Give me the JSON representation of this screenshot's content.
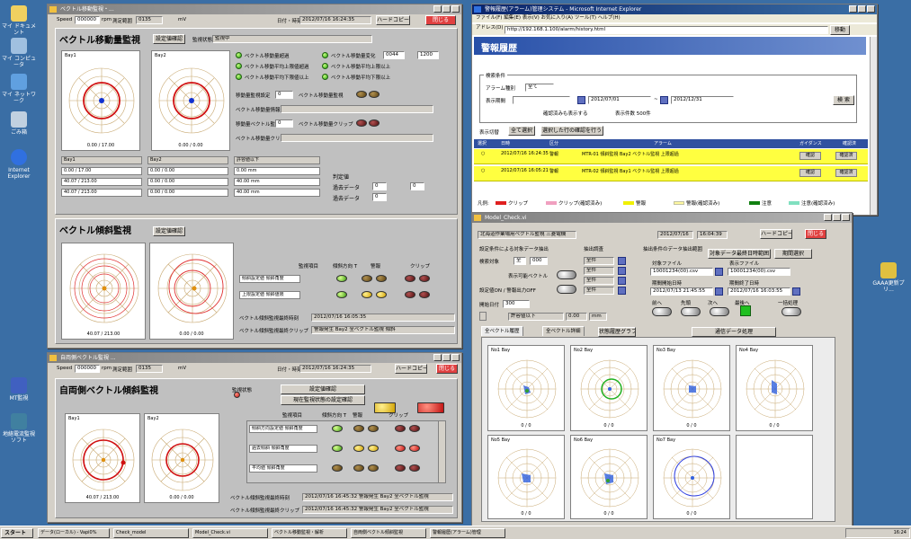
{
  "desktop_icons": [
    {
      "label": "マイ ドキュメント",
      "color": "#f0d060"
    },
    {
      "label": "マイ コンピュータ",
      "color": "#a0c0e0"
    },
    {
      "label": "マイ ネットワーク",
      "color": "#60a0e0"
    },
    {
      "label": "ごみ箱",
      "color": "#c0d0e0"
    },
    {
      "label": "Internet Explorer",
      "color": "#3070e0"
    },
    {
      "label": "MT監視",
      "color": "#4060c0"
    },
    {
      "label": "地絡電流監視ソフト",
      "color": "#4080a0"
    }
  ],
  "desktop_right_icon": {
    "label": "GAAA更新プリ..."
  },
  "win1": {
    "title": "ベクトル移動監視・...",
    "speed_label": "Speed",
    "speed_value": "000000",
    "speed_unit": "rpm",
    "range_label": "測定範囲",
    "range_value": "0135",
    "range_unit": "mV",
    "datetime_label": "日付・時刻",
    "datetime_value": "2012/07/16 16:24:35",
    "hardcopy_button": "ハードコピー",
    "close_button": "閉じる",
    "panel1": {
      "title": "ベクトル移動量監視",
      "settings_button": "設定値確認",
      "status_label": "監視状態",
      "status_value": "監視中",
      "polar1_label": "Bay1",
      "polar2_label": "Bay2",
      "polar1_value": "0.00 / 17.00",
      "polar2_value": "0.00 / 0.00",
      "checks": [
        "ベクトル移動量超過",
        "ベクトル移動平均上限値超過",
        "ベクトル移動平均下限値以上"
      ],
      "checks_right": [
        "ベクトル移動量変化",
        "ベクトル移動平均上限以上",
        "ベクトル移動平均下限以上"
      ],
      "threshold_value": "0044",
      "threshold_value2": "1200",
      "alarm_label": "移動量監視設定",
      "alarm_value": "0",
      "alarm_label2": "ベクトル移動量監視",
      "info_label": "ベクトル移動量情報",
      "count_label": "移動量ベクトル監視",
      "count_value": "0",
      "count_label2": "ベクトル移動量クリップ",
      "clip_label": "ベクトル移動量クリップ",
      "table_headers": [
        "Bay1",
        "Bay2",
        "許容値以下"
      ],
      "table_rows": [
        [
          "0.00 /  17.00",
          "0.00 / 0.00",
          "0.00  mm"
        ],
        [
          "40.07 /  213.00",
          "0.00 / 0.00",
          "40.00  mm"
        ],
        [
          "40.07 /  213.00",
          "0.00 / 0.00",
          "40.00  mm"
        ]
      ],
      "side_labels": [
        "判定値",
        "過去データ",
        "過去データ"
      ],
      "side_values": [
        "0",
        "0",
        "0"
      ]
    },
    "panel2": {
      "title": "ベクトル傾斜監視",
      "settings_button": "設定値確認",
      "polar1_value": "40.07 /  213.00",
      "polar2_value": "0.00 / 0.00",
      "col_headers": [
        "監視項目",
        "傾斜方向 T",
        "警報",
        "クリップ"
      ],
      "rows": [
        "傾斜設定値 傾斜角度",
        "上限設定値 傾斜値限"
      ],
      "bottom_labels": [
        "ベクトル傾斜監視最終時刻",
        "ベクトル傾斜監視最終クリップ"
      ],
      "bottom_values": [
        "2012/07/16 16:05:35",
        "警報発生 Bay2 全ベクトル監視 傾斜"
      ]
    }
  },
  "win2": {
    "title": "自両側ベクトル監視 ...",
    "speed_label": "Speed",
    "speed_value": "000000",
    "speed_unit": "rpm",
    "range_label": "測定範囲",
    "range_value": "0135",
    "range_unit": "mV",
    "datetime_label": "日付・時刻",
    "datetime_value": "2012/07/16 16:24:35",
    "hardcopy_button": "ハードコピー",
    "close_button": "閉じる",
    "panel_title": "自両側ベクトル傾斜監視",
    "polar1_label": "Bay1",
    "polar2_label": "Bay2",
    "polar1_value": "40.07 / 213.00",
    "polar2_value": "0.00 / 0.00",
    "settings_button": "設定値確認",
    "sub_button": "現在監視状態の設定確認",
    "monitor_label": "監視状態",
    "monitor_value": "0",
    "col_headers": [
      "監視項目",
      "傾斜方向 T",
      "警報",
      "クリップ"
    ],
    "rows": [
      "傾斜方向設定値 傾斜角度",
      "過去傾斜 傾斜角度",
      "平均値 傾斜角度"
    ],
    "bottom_labels": [
      "ベクトル傾斜監視最終時刻",
      "ベクトル傾斜監視最終クリップ"
    ],
    "bottom_values": [
      "2012/07/16 16:45:32 警報発生 Bay2 全ベクトル監視",
      "2012/07/16 16:45:32 警報発生 Bay2 全ベクトル監視"
    ]
  },
  "win3": {
    "title": "警報履歴(アラーム)管理システム - Microsoft Internet Explorer",
    "menu": "ファイル(F)  編集(E)  表示(V)  お気に入り(A)  ツール(T)  ヘルプ(H)",
    "address_label": "アドレス(D)",
    "address_value": "http://192.168.1.100/alarm/history.html",
    "go_button": "移動",
    "page_header": "警報履歴",
    "search_title": "検索条件",
    "alarm_type_label": "アラーム種別",
    "alarm_type_value": "全て",
    "period_label": "表示期間",
    "period_from": "2012/07/01",
    "period_to": "2012/12/31",
    "unconfirmed_label": "確認済みも表示する",
    "max_label": "表示件数 500件",
    "search_button": "検 索",
    "toolbar_items": [
      "表示切替",
      "全て選択",
      "選択した行の確認を行う"
    ],
    "table_headers": [
      "選択",
      "日時",
      "区分",
      "アラーム",
      "ガイダンス",
      "確認済"
    ],
    "rows": [
      {
        "date": "2012/07/16 16:24:35",
        "kind": "警報",
        "alarm": "MTR-01 傾斜監視 Bay2 ベクトル監視 上限超過",
        "btn1": "確認",
        "btn2": "確認済"
      },
      {
        "date": "2012/07/16 16:05:21",
        "kind": "警報",
        "alarm": "MTR-02 傾斜監視 Bay1 ベクトル監視 上限超過",
        "btn1": "確認",
        "btn2": "確認済"
      }
    ],
    "legend_label": "凡例:",
    "legend": [
      {
        "label": "クリップ",
        "color": "#e02020"
      },
      {
        "label": "クリップ(確認済み)",
        "color": "#f0a0c0"
      },
      {
        "label": "警報",
        "color": "#f0f000"
      },
      {
        "label": "警報(確認済み)",
        "color": "#fff8a0"
      },
      {
        "label": "注意",
        "color": "#108010"
      },
      {
        "label": "注意(確認済み)",
        "color": "#80e0c0"
      }
    ]
  },
  "win4": {
    "title": "Model_Check.vi",
    "breadcrumb": "北海道作業場用ベクトル監視 三菱電機",
    "date": "2012/07/16",
    "time": "16:04:39",
    "hardcopy_button": "ハードコピー",
    "close_button": "閉じる",
    "left_title": "設定条件による対象データ抽出",
    "left_title2": "抽出調査",
    "left_labels": [
      "検索対象",
      "表示可能ベクトル",
      "設定値ON / 警報出力OFF"
    ],
    "left_values": [
      "全",
      "000"
    ],
    "left_results": [
      "全件",
      "全件",
      "全件",
      "全件"
    ],
    "right_title": "抽出条件のデータ抽出範囲",
    "right_btn1": "対象データ最終日時範囲",
    "right_btn2": "期間選択",
    "file_label1": "対象ファイル",
    "file_label2": "表示ファイル",
    "file_value1": "10001234(00).csv",
    "file_value2": "10001234(00).csv",
    "time_label1": "期間開始日時",
    "time_label2": "期間終了日時",
    "time_value1": "2012/07/13 21:45:55",
    "time_value2": "2012/07/16 16:03:55",
    "nav_labels": [
      "前へ",
      "先頭",
      "次へ",
      "最後へ",
      "一括処理"
    ],
    "status_label": "開始日付",
    "status_value": "300",
    "info_field": "許容値以下",
    "info_value": "0.00",
    "info_unit": "mm",
    "tabs": [
      "全ベクトル履歴",
      "全ベクトル詳細"
    ],
    "tab_btn": "状態履歴グラフ",
    "sel_button": "通信データ処理",
    "polars": [
      {
        "label": "No1 Bay",
        "value": "0 /  0"
      },
      {
        "label": "No2 Bay",
        "value": "0 /  0"
      },
      {
        "label": "No3 Bay",
        "value": "0 /  0"
      },
      {
        "label": "No4 Bay",
        "value": "0 /  0"
      },
      {
        "label": "No5 Bay",
        "value": "0 /  0"
      },
      {
        "label": "No6 Bay",
        "value": "0 /  0"
      },
      {
        "label": "No7 Bay",
        "value": "0 /  0"
      }
    ]
  },
  "taskbar": {
    "start": "スタート",
    "items": [
      "データ(ローカル) - Vapi0%",
      "Check_model",
      "Model_Check.vi",
      "ベクトル移動監視・解析",
      "自両側ベクトル傾斜監視",
      "警報履歴(アラーム)管理"
    ],
    "clock": "16:24"
  }
}
